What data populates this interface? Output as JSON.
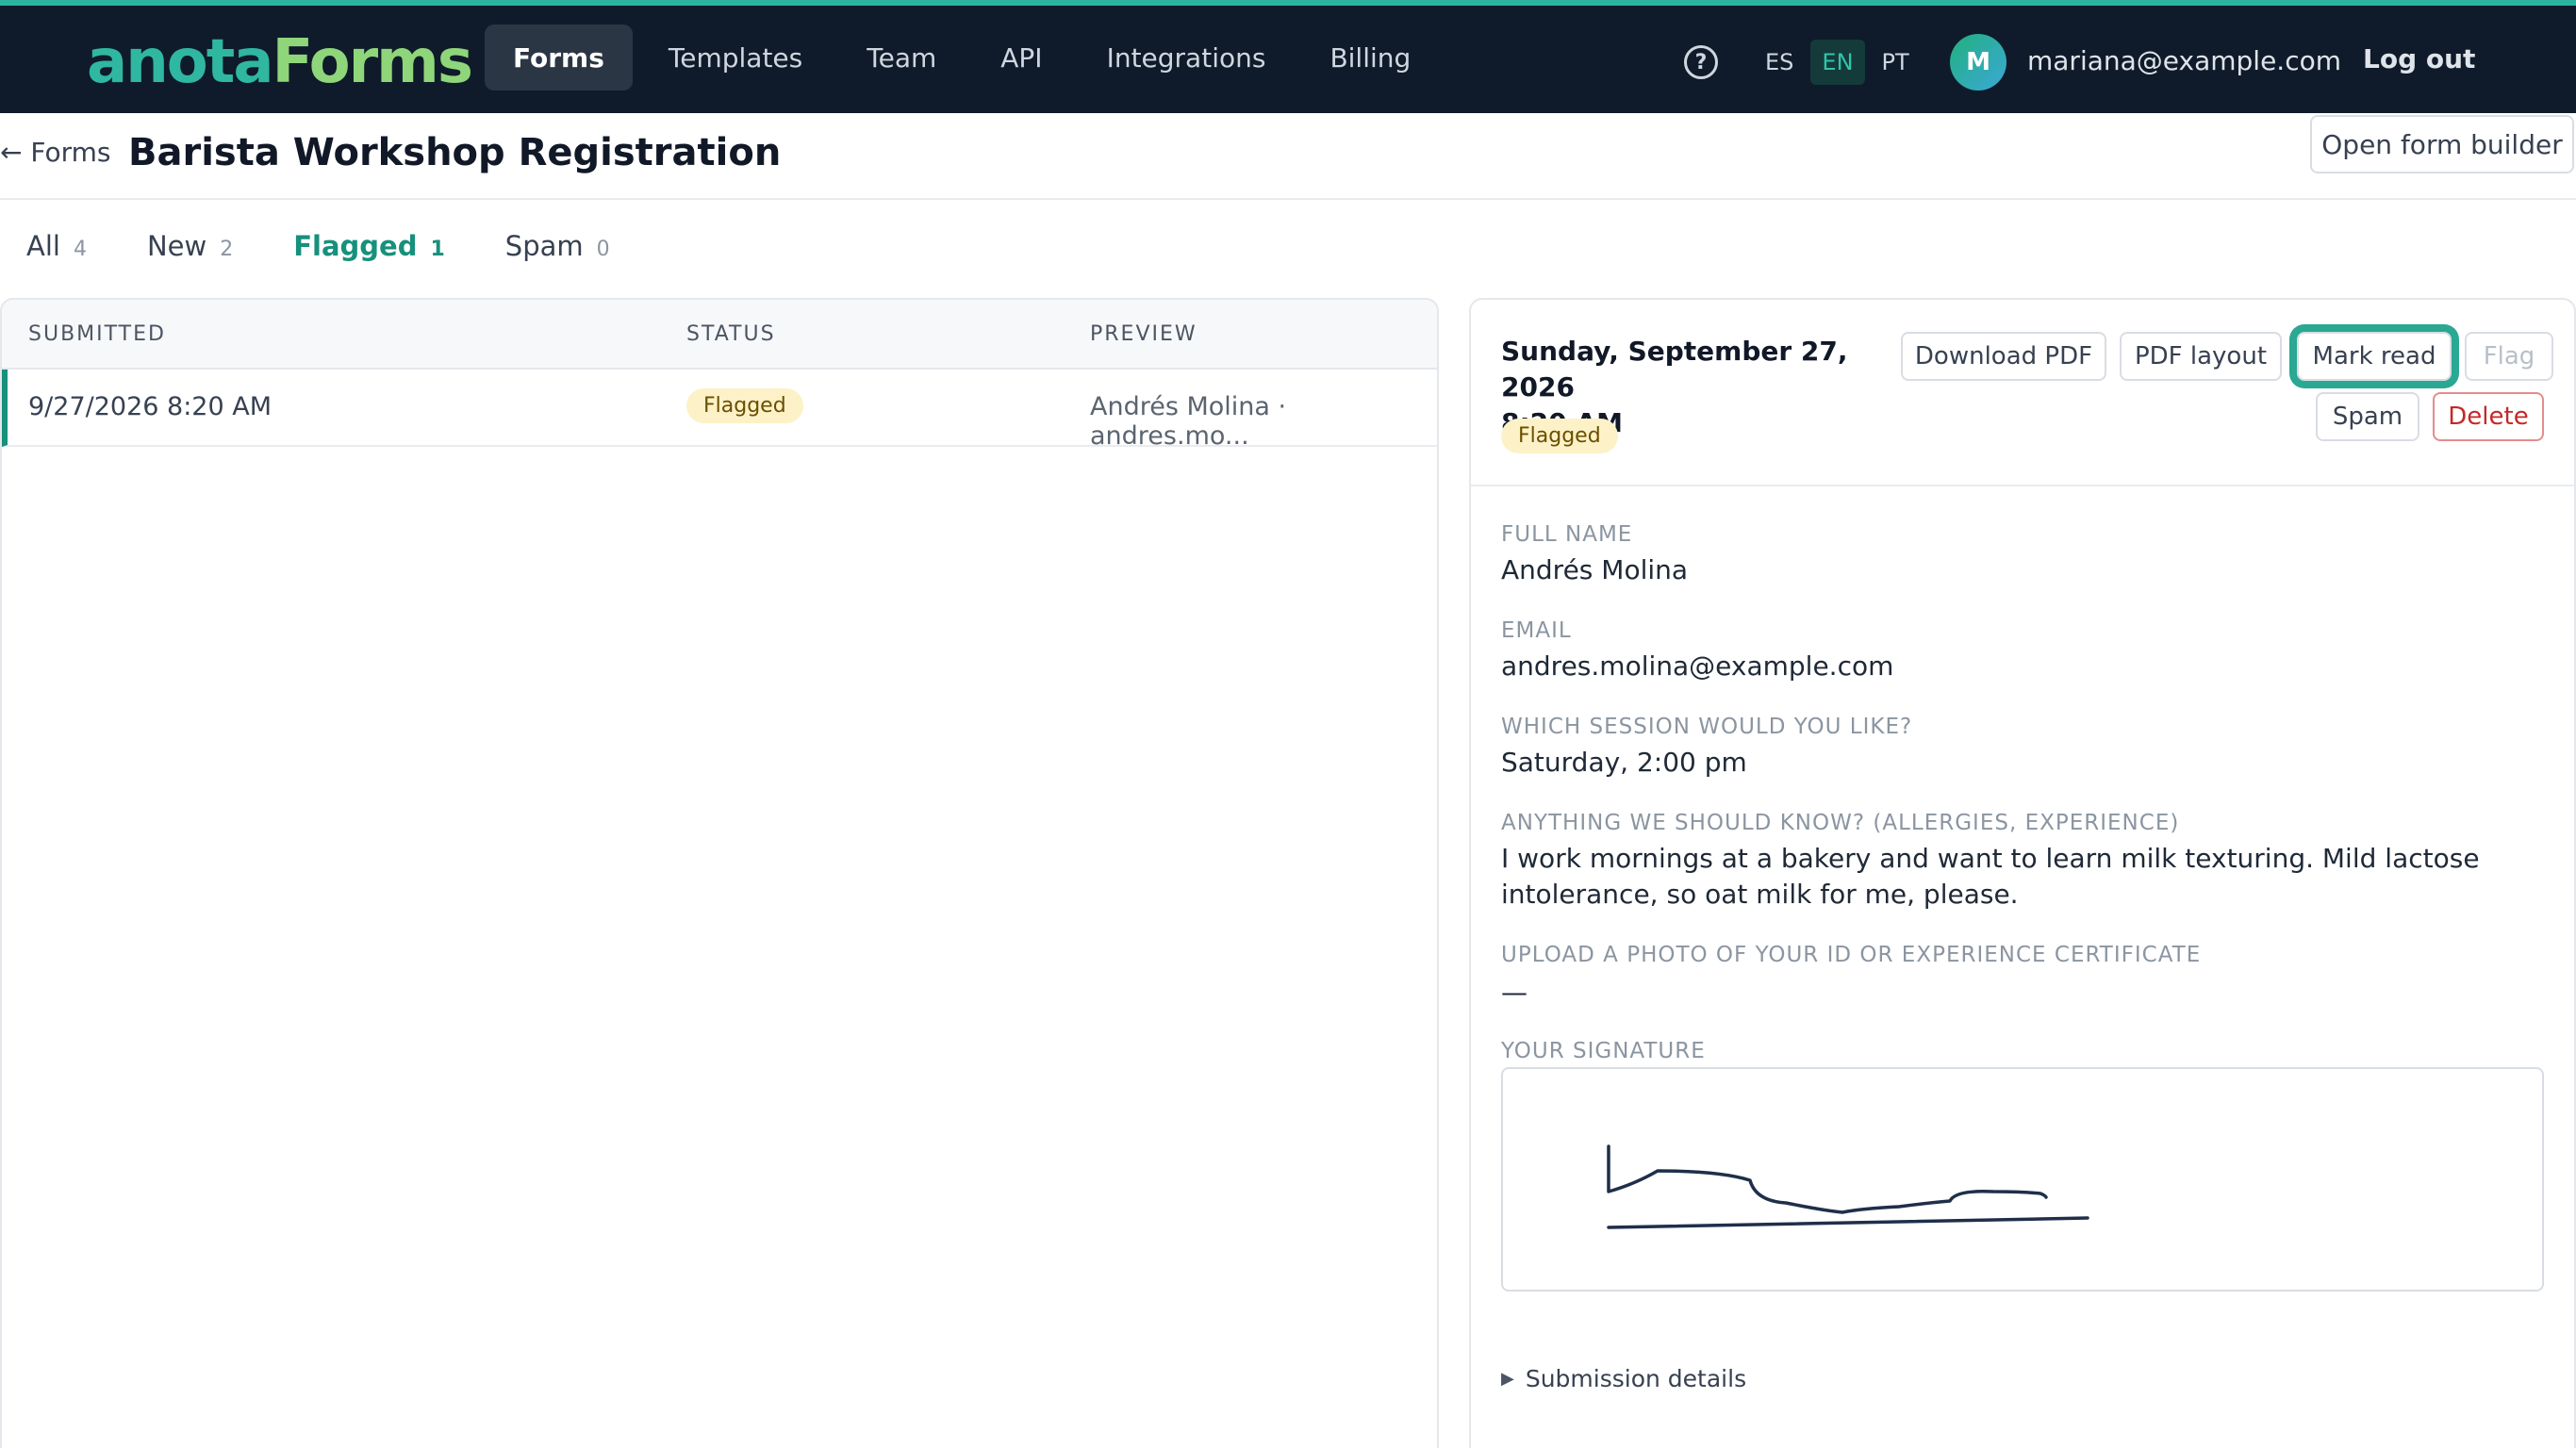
{
  "brand": {
    "part1": "anota",
    "part2": "Forms"
  },
  "nav": {
    "items": [
      "Forms",
      "Templates",
      "Team",
      "API",
      "Integrations",
      "Billing"
    ]
  },
  "help_icon": "question-circle-icon",
  "languages": [
    "ES",
    "EN",
    "PT"
  ],
  "user": {
    "initial": "M",
    "email": "mariana@example.com",
    "logout": "Log out"
  },
  "header": {
    "back": "← Forms",
    "title": "Barista Workshop Registration",
    "open_builder": "Open form builder"
  },
  "tabs": [
    {
      "label": "All",
      "count": "4"
    },
    {
      "label": "New",
      "count": "2"
    },
    {
      "label": "Flagged",
      "count": "1"
    },
    {
      "label": "Spam",
      "count": "0"
    }
  ],
  "table": {
    "columns": [
      "SUBMITTED",
      "STATUS",
      "PREVIEW"
    ],
    "rows": [
      {
        "submitted": "9/27/2026 8:20 AM",
        "status": "Flagged",
        "preview": "Andrés Molina · andres.mo..."
      }
    ]
  },
  "detail": {
    "date_line1": "Sunday, September 27, 2026",
    "date_line2": "8:20 AM",
    "status": "Flagged",
    "actions": {
      "download_pdf": "Download PDF",
      "pdf_layout": "PDF layout",
      "mark_read": "Mark read",
      "flag": "Flag",
      "spam": "Spam",
      "delete": "Delete"
    },
    "fields": [
      {
        "label": "FULL NAME",
        "value": "Andrés Molina"
      },
      {
        "label": "EMAIL",
        "value": "andres.molina@example.com"
      },
      {
        "label": "WHICH SESSION WOULD YOU LIKE?",
        "value": "Saturday, 2:00 pm"
      },
      {
        "label": "ANYTHING WE SHOULD KNOW? (ALLERGIES, EXPERIENCE)",
        "value": "I work mornings at a bakery and want to learn milk texturing. Mild lactose intolerance, so oat milk for me, please."
      },
      {
        "label": "UPLOAD A PHOTO OF YOUR ID OR EXPERIENCE CERTIFICATE",
        "value": "—"
      },
      {
        "label": "YOUR SIGNATURE",
        "value": ""
      }
    ],
    "details_toggle": "Submission details"
  },
  "colors": {
    "accent": "#17907c",
    "topbar": "#0f1b2a",
    "badge_bg": "#fdf1c7",
    "danger": "#c62828"
  }
}
